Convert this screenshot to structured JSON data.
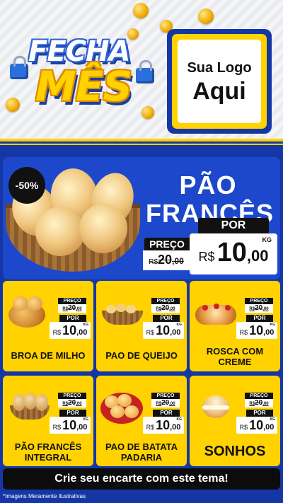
{
  "header": {
    "title_line1": "FECHA",
    "title_line2": "MÊS",
    "logo_line1": "Sua Logo",
    "logo_line2": "Aqui"
  },
  "hero": {
    "discount": "-50%",
    "name_line1": "PÃO",
    "name_line2": "FRANCÊS",
    "old_label": "PREÇO",
    "old_currency": "R$",
    "old_int": "20",
    "old_dec": ",00",
    "new_label": "POR",
    "currency": "R$",
    "price_int": "10",
    "price_dec": ",00",
    "unit": "KG"
  },
  "products": [
    {
      "name": "BROA DE MILHO",
      "old_label": "PREÇO",
      "old_int": "20",
      "old_dec": ",00",
      "old_currency": "R$",
      "new_label": "POR",
      "currency": "R$",
      "price_int": "10",
      "price_dec": ",00",
      "unit": "KG"
    },
    {
      "name": "PAO DE QUEIJO",
      "old_label": "PREÇO",
      "old_int": "20",
      "old_dec": ",00",
      "old_currency": "R$",
      "new_label": "POR",
      "currency": "R$",
      "price_int": "10",
      "price_dec": ",00",
      "unit": "KG"
    },
    {
      "name": "ROSCA COM CREME",
      "old_label": "PREÇO",
      "old_int": "20",
      "old_dec": ",00",
      "old_currency": "R$",
      "new_label": "POR",
      "currency": "R$",
      "price_int": "10",
      "price_dec": ",00",
      "unit": "KG"
    },
    {
      "name": "PÃO FRANCÊS INTEGRAL",
      "old_label": "PREÇO",
      "old_int": "20",
      "old_dec": ",00",
      "old_currency": "R$",
      "new_label": "POR",
      "currency": "R$",
      "price_int": "10",
      "price_dec": ",00",
      "unit": "KG"
    },
    {
      "name": "PAO DE BATATA PADARIA",
      "old_label": "PREÇO",
      "old_int": "20",
      "old_dec": ",00",
      "old_currency": "R$",
      "new_label": "POR",
      "currency": "R$",
      "price_int": "10",
      "price_dec": ",00",
      "unit": "KG"
    },
    {
      "name": "SONHOS",
      "old_label": "PREÇO",
      "old_int": "20",
      "old_dec": ",00",
      "old_currency": "R$",
      "new_label": "POR",
      "currency": "R$",
      "price_int": "10",
      "price_dec": ",00",
      "unit": "KG"
    }
  ],
  "cta": "Crie seu encarte com este tema!",
  "disclaimer": "*Imagens Meramente Ilustrativas",
  "colors": {
    "blue": "#1537a6",
    "hero_blue": "#1d48cc",
    "yellow": "#ffd200",
    "black": "#0c0c0c"
  }
}
